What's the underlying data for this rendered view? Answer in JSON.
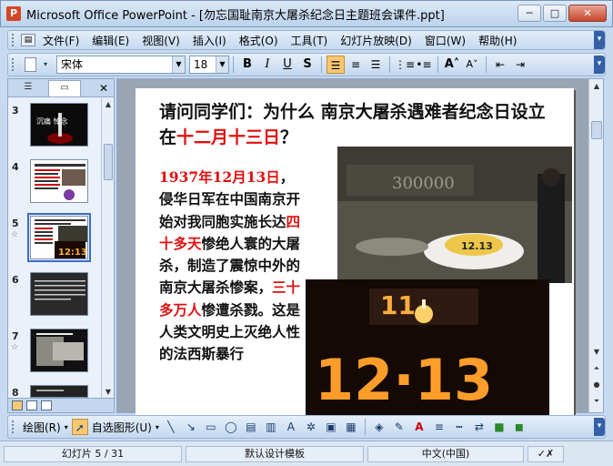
{
  "window": {
    "title": "Microsoft Office PowerPoint - [勿忘国耻南京大屠杀纪念日主题班会课件.ppt]"
  },
  "menu": {
    "items": [
      "文件(F)",
      "编辑(E)",
      "视图(V)",
      "插入(I)",
      "格式(O)",
      "工具(T)",
      "幻灯片放映(D)",
      "窗口(W)",
      "帮助(H)"
    ]
  },
  "toolbar": {
    "font": "宋体",
    "size": "18",
    "bold": "B",
    "italic": "I",
    "underline": "U",
    "shadow": "S"
  },
  "thumbnails": [
    {
      "num": "3",
      "star": ""
    },
    {
      "num": "4",
      "star": ""
    },
    {
      "num": "5",
      "star": "☆"
    },
    {
      "num": "6",
      "star": ""
    },
    {
      "num": "7",
      "star": "☆"
    },
    {
      "num": "8",
      "star": ""
    }
  ],
  "thumb_texts": {
    "slide3": "沉痛 悼念",
    "slide5_clock": "12:13"
  },
  "slide": {
    "title_part1": "请问同学们：为什么 南京大屠杀遇难者纪念日设立在",
    "title_highlight": "十二月十三日",
    "title_part2": "？",
    "body_date": "1937年12月13日",
    "body_part1": "，侵华日军在中国南京开始对我同胞实施长达",
    "body_highlight1": "四十多天",
    "body_part2": "惨绝人寰的大屠杀，制造了震惊中外的南京大屠杀惨案，",
    "body_highlight2": "三十多万人",
    "body_part3": "惨遭杀戮。这是人类文明史上灭绝人性的法西斯暴行"
  },
  "photos": {
    "photo1_wall": "300000",
    "photo1_wreath": "12.13",
    "photo2_candles": "12·13"
  },
  "drawbar": {
    "draw": "绘图(R)",
    "autoshape": "自选图形(U)"
  },
  "status": {
    "slide": "幻灯片 5 / 31",
    "template": "默认设计模板",
    "language": "中文(中国)"
  },
  "colors": {
    "accent_red": "#e01010"
  }
}
